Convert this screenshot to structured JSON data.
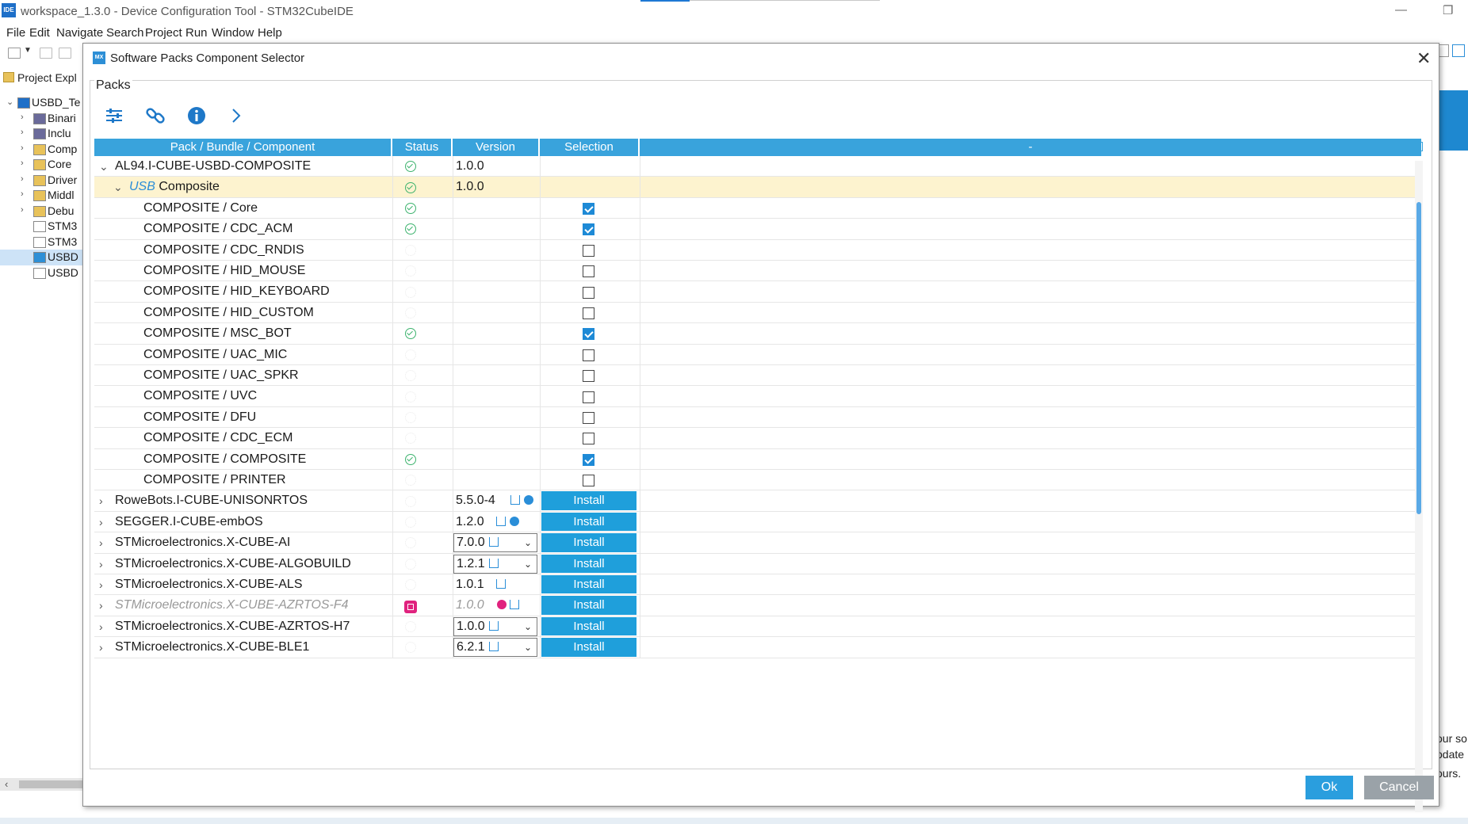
{
  "ide": {
    "window_title": "workspace_1.3.0 - Device Configuration Tool - STM32CubeIDE",
    "logo_text": "IDE",
    "menu": [
      "File",
      "Edit",
      "Navigate",
      "Search",
      "Project",
      "Run",
      "Window",
      "Help"
    ],
    "explorer_tab": "Project Expl",
    "tree": [
      {
        "label": "USBD_Te",
        "icon": "project-icon"
      },
      {
        "label": "Binari",
        "icon": "binaries-icon"
      },
      {
        "label": "Inclu",
        "icon": "includes-icon"
      },
      {
        "label": "Comp",
        "icon": "folder-icon"
      },
      {
        "label": "Core",
        "icon": "folder-icon"
      },
      {
        "label": "Driver",
        "icon": "folder-icon"
      },
      {
        "label": "Middl",
        "icon": "folder-icon"
      },
      {
        "label": "Debu",
        "icon": "folder-icon"
      },
      {
        "label": "STM3",
        "icon": "file-icon"
      },
      {
        "label": "STM3",
        "icon": "file-icon"
      },
      {
        "label": "USBD",
        "icon": "mx-file-icon"
      },
      {
        "label": "USBD",
        "icon": "file-icon"
      }
    ],
    "right_snippets": [
      "our so",
      "odate",
      "ours."
    ]
  },
  "dialog": {
    "title": "Software Packs Component Selector",
    "icon_text": "MX",
    "group_label": "Packs",
    "toolbar_icons": [
      "filter-settings-icon",
      "link-icon",
      "info-icon",
      "chevron-right-icon"
    ],
    "headers": {
      "name": "Pack / Bundle / Component",
      "status": "Status",
      "version": "Version",
      "selection": "Selection",
      "extra": "-"
    },
    "rows": [
      {
        "kind": "pack",
        "expanded": true,
        "name": "AL94.I-CUBE-USBD-COMPOSITE",
        "status": "ok",
        "version": "1.0.0",
        "selection": "none"
      },
      {
        "kind": "bundle",
        "expanded": true,
        "name_prefix": "USB",
        "name": "Composite",
        "status": "ok",
        "version": "1.0.0",
        "selection": "none",
        "highlight": true
      },
      {
        "kind": "component",
        "name": "COMPOSITE / Core",
        "status": "ok",
        "selection": "checked"
      },
      {
        "kind": "component",
        "name": "COMPOSITE / CDC_ACM",
        "status": "ok",
        "selection": "checked"
      },
      {
        "kind": "component",
        "name": "COMPOSITE / CDC_RNDIS",
        "status": "none",
        "selection": "unchecked"
      },
      {
        "kind": "component",
        "name": "COMPOSITE / HID_MOUSE",
        "status": "none",
        "selection": "unchecked"
      },
      {
        "kind": "component",
        "name": "COMPOSITE / HID_KEYBOARD",
        "status": "none",
        "selection": "unchecked"
      },
      {
        "kind": "component",
        "name": "COMPOSITE / HID_CUSTOM",
        "status": "none",
        "selection": "unchecked"
      },
      {
        "kind": "component",
        "name": "COMPOSITE / MSC_BOT",
        "status": "ok",
        "selection": "checked"
      },
      {
        "kind": "component",
        "name": "COMPOSITE / UAC_MIC",
        "status": "none",
        "selection": "unchecked"
      },
      {
        "kind": "component",
        "name": "COMPOSITE / UAC_SPKR",
        "status": "none",
        "selection": "unchecked"
      },
      {
        "kind": "component",
        "name": "COMPOSITE / UVC",
        "status": "none",
        "selection": "unchecked"
      },
      {
        "kind": "component",
        "name": "COMPOSITE / DFU",
        "status": "none",
        "selection": "unchecked"
      },
      {
        "kind": "component",
        "name": "COMPOSITE / CDC_ECM",
        "status": "none",
        "selection": "unchecked"
      },
      {
        "kind": "component",
        "name": "COMPOSITE / COMPOSITE",
        "status": "ok",
        "selection": "checked"
      },
      {
        "kind": "component",
        "name": "COMPOSITE / PRINTER",
        "status": "none",
        "selection": "unchecked"
      },
      {
        "kind": "pack",
        "expanded": false,
        "name": "RoweBots.I-CUBE-UNISONRTOS",
        "status": "none",
        "version": "5.5.0-4",
        "version_style": "text",
        "icons": [
          "download-icon",
          "globe-icon"
        ],
        "selection": "install"
      },
      {
        "kind": "pack",
        "expanded": false,
        "name": "SEGGER.I-CUBE-embOS",
        "status": "none",
        "version": "1.2.0",
        "version_style": "text",
        "icons": [
          "download-icon",
          "globe-icon"
        ],
        "selection": "install"
      },
      {
        "kind": "pack",
        "expanded": false,
        "name": "STMicroelectronics.X-CUBE-AI",
        "status": "none",
        "version": "7.0.0",
        "version_style": "dropdown",
        "icons": [
          "download-icon"
        ],
        "selection": "install"
      },
      {
        "kind": "pack",
        "expanded": false,
        "name": "STMicroelectronics.X-CUBE-ALGOBUILD",
        "status": "none",
        "version": "1.2.1",
        "version_style": "dropdown",
        "icons": [
          "download-icon"
        ],
        "selection": "install"
      },
      {
        "kind": "pack",
        "expanded": false,
        "name": "STMicroelectronics.X-CUBE-ALS",
        "status": "none",
        "version": "1.0.1",
        "version_style": "text",
        "icons": [
          "download-icon"
        ],
        "selection": "install"
      },
      {
        "kind": "pack",
        "expanded": false,
        "disabled": true,
        "name": "STMicroelectronics.X-CUBE-AZRTOS-F4",
        "status": "chip",
        "version": "1.0.0",
        "version_style": "text",
        "icons": [
          "error-icon",
          "download-icon"
        ],
        "selection": "install"
      },
      {
        "kind": "pack",
        "expanded": false,
        "name": "STMicroelectronics.X-CUBE-AZRTOS-H7",
        "status": "none",
        "version": "1.0.0",
        "version_style": "dropdown",
        "icons": [
          "download-icon"
        ],
        "selection": "install"
      },
      {
        "kind": "pack",
        "expanded": false,
        "name": "STMicroelectronics.X-CUBE-BLE1",
        "status": "none",
        "version": "6.2.1",
        "version_style": "dropdown",
        "icons": [
          "download-icon"
        ],
        "selection": "install"
      }
    ],
    "install_label": "Install",
    "ok_label": "Ok",
    "cancel_label": "Cancel",
    "colors": {
      "header": "#39a3dc",
      "install": "#1f9fdb",
      "check": "#1e8ad6",
      "status_ok": "#3db36e",
      "highlight": "#fdf3cf",
      "error": "#e0227e"
    }
  }
}
